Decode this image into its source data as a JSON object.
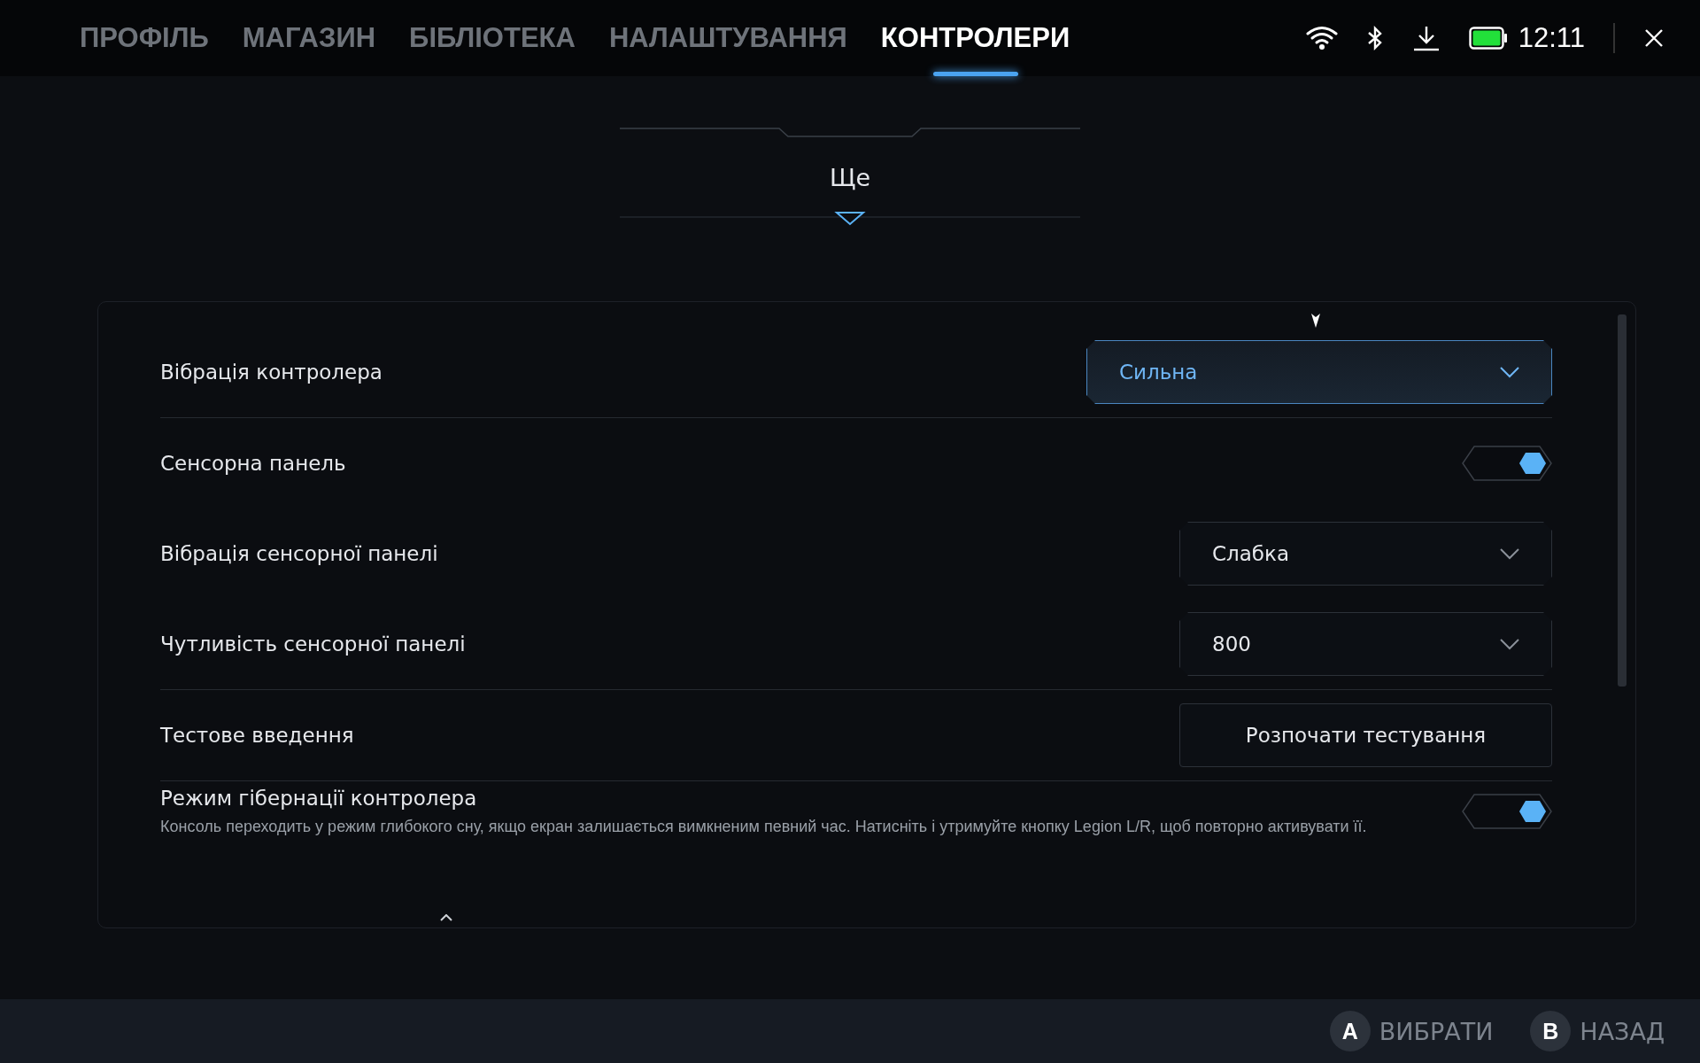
{
  "tabs": [
    {
      "label": "ПРОФІЛЬ",
      "selected": false
    },
    {
      "label": "МАГАЗИН",
      "selected": false
    },
    {
      "label": "БІБЛІОТЕКА",
      "selected": false
    },
    {
      "label": "НАЛАШТУВАННЯ",
      "selected": false
    },
    {
      "label": "КОНТРОЛЕРИ",
      "selected": true
    }
  ],
  "status": {
    "time": "12:11",
    "level": 1
  },
  "more": {
    "label": "Ще"
  },
  "sections": [
    [
      {
        "kind": "dropdown",
        "label": "Вібрація контролера",
        "value": "Сильна",
        "selected": true
      }
    ],
    [
      {
        "kind": "toggle",
        "label": "Сенсорна панель",
        "on": true
      },
      {
        "kind": "dropdown",
        "label": "Вібрація сенсорної панелі",
        "value": "Слабка",
        "selected": false
      },
      {
        "kind": "dropdown",
        "label": "Чутливість сенсорної панелі",
        "value": "800",
        "selected": false
      }
    ],
    [
      {
        "kind": "button",
        "label": "Тестове введення",
        "button": "Розпочати тестування"
      }
    ],
    [
      {
        "kind": "toggle",
        "label": "Режим гібернації контролера",
        "description": "Консоль переходить у режим глибокого сну, якщо екран залишається вимкненим певний час. Натисніть і утримуйте кнопку Legion L/R, щоб повторно активувати її.",
        "on": true
      }
    ]
  ],
  "footer": [
    {
      "key": "A",
      "label": "ВИБРАТИ"
    },
    {
      "key": "B",
      "label": "НАЗАД"
    }
  ]
}
